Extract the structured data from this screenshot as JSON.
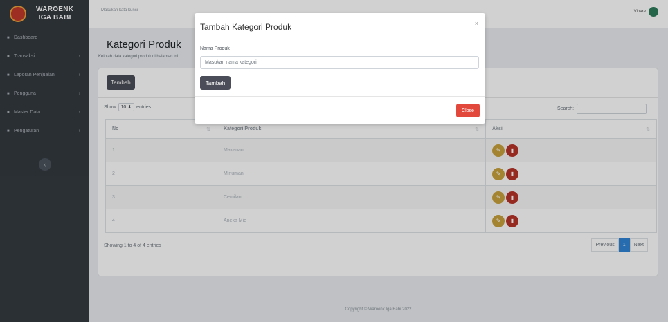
{
  "brand": {
    "line1": "WAROENK",
    "line2": "IGA BABI"
  },
  "sidebar": {
    "items": [
      {
        "label": "Dashboard",
        "icon": "dashboard-icon",
        "chevron": false
      },
      {
        "label": "Transaksi",
        "icon": "cart-icon",
        "chevron": true
      },
      {
        "label": "Laporan Penjualan",
        "icon": "report-icon",
        "chevron": true
      },
      {
        "label": "Pengguna",
        "icon": "users-icon",
        "chevron": true
      },
      {
        "label": "Master Data",
        "icon": "database-icon",
        "chevron": true
      },
      {
        "label": "Pengaturan",
        "icon": "gear-icon",
        "chevron": true
      }
    ]
  },
  "topbar": {
    "search_placeholder": "Masukan kata kunci",
    "user_name": "Vinare"
  },
  "page": {
    "title": "Kategori Produk",
    "subtitle": "Kelolah data kategori produk di halaman ini"
  },
  "card": {
    "tambah_label": "Tambah",
    "show_label": "Show",
    "entries_value": "10",
    "entries_label": "entries",
    "search_label": "Search:",
    "columns": [
      "No",
      "Kategori Produk",
      "Aksi"
    ],
    "rows": [
      {
        "no": "1",
        "kategori": "Makanan"
      },
      {
        "no": "2",
        "kategori": "Minuman"
      },
      {
        "no": "3",
        "kategori": "Cemilan"
      },
      {
        "no": "4",
        "kategori": "Aneka Mie"
      }
    ],
    "showing": "Showing 1 to 4 of 4 entries",
    "pagination": {
      "prev": "Previous",
      "current": "1",
      "next": "Next"
    }
  },
  "footer": "Copyright © Waroenk Iga Babi 2022",
  "modal": {
    "title": "Tambah Kategori Produk",
    "close_x": "×",
    "field_label": "Nama Produk",
    "field_placeholder": "Masukan nama kategori",
    "submit_label": "Tambah",
    "close_label": "Close"
  },
  "colors": {
    "sidebar": "#343a40",
    "primary_dark": "#4b4e58",
    "danger": "#e2483c",
    "edit": "#c9a23b",
    "delete": "#b83429",
    "page_active": "#2f84d6"
  }
}
